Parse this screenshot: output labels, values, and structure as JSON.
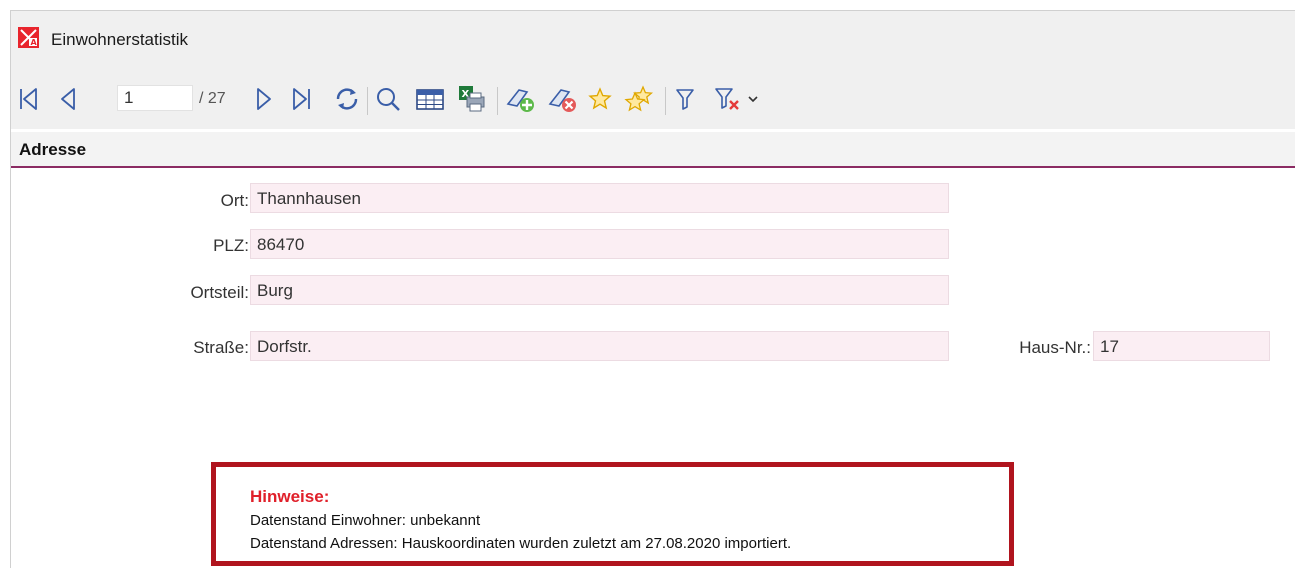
{
  "window": {
    "title": "Einwohnerstatistik",
    "icon": "kgi-app-icon"
  },
  "toolbar": {
    "record_current": "1",
    "record_total": "/ 27",
    "buttons": [
      "first-record-icon",
      "previous-record-icon",
      "next-record-icon",
      "last-record-icon",
      "refresh-icon",
      "search-icon",
      "table-view-icon",
      "excel-export-icon",
      "add-feature-icon",
      "delete-feature-icon",
      "favorite-icon",
      "favorites-icon",
      "filter-icon",
      "clear-filter-icon",
      "dropdown-chevron-icon"
    ]
  },
  "section": {
    "title": "Adresse"
  },
  "form": {
    "ort": {
      "label": "Ort:",
      "value": "Thannhausen"
    },
    "plz": {
      "label": "PLZ:",
      "value": "86470"
    },
    "ortsteil": {
      "label": "Ortsteil:",
      "value": "Burg"
    },
    "strasse": {
      "label": "Straße:",
      "value": "Dorfstr."
    },
    "hausnr": {
      "label": "Haus-Nr.:",
      "value": "17"
    }
  },
  "notice": {
    "title": "Hinweise:",
    "line1": "Datenstand Einwohner: unbekannt",
    "line2": "Datenstand Adressen: Hauskoordinaten wurden zuletzt am 27.08.2020 importiert."
  },
  "colors": {
    "accent": "#8b2b63",
    "field_bg": "#fbeef3",
    "notice_border": "#b0141e",
    "notice_title": "#e0202a",
    "icon_blue": "#3a5ea8"
  }
}
